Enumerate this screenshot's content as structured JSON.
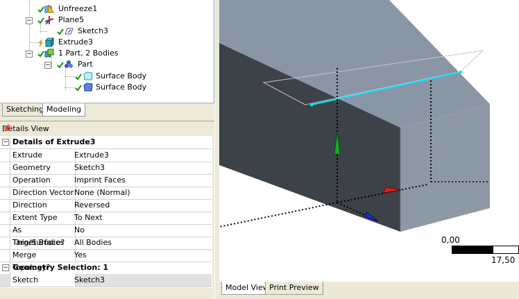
{
  "tree": {
    "items": [
      {
        "label": "Unfreeze1",
        "icon": "unfreeze-icon"
      },
      {
        "label": "Plane5",
        "icon": "plane-icon"
      },
      {
        "label": "Sketch3",
        "icon": "sketch-icon"
      },
      {
        "label": "Extrude3",
        "icon": "extrude-icon"
      },
      {
        "label": "1 Part, 2 Bodies",
        "icon": "part-bodies-icon"
      },
      {
        "label": "Part",
        "icon": "part-icon"
      },
      {
        "label": "Surface Body",
        "icon": "surface-body-icon"
      },
      {
        "label": "Surface Body",
        "icon": "surface-body-icon"
      }
    ]
  },
  "left_tabs": {
    "sketching": "Sketching",
    "modeling": "Modeling"
  },
  "details": {
    "title": "Details View",
    "group1": "Details of Extrude3",
    "rows": [
      {
        "label": "Extrude",
        "value": "Extrude3"
      },
      {
        "label": "Geometry",
        "value": "Sketch3"
      },
      {
        "label": "Operation",
        "value": "Imprint Faces"
      },
      {
        "label": "Direction Vector",
        "value": "None (Normal)"
      },
      {
        "label": "Direction",
        "value": "Reversed"
      },
      {
        "label": "Extent Type",
        "value": "To Next"
      },
      {
        "label": "As Thin/Surface?",
        "value": "No"
      },
      {
        "label": "Target Bodies",
        "value": "All Bodies"
      },
      {
        "label": "Merge Topology?",
        "value": "Yes"
      }
    ],
    "group2": "Geometry Selection: 1",
    "row_sel": {
      "label": "Sketch",
      "value": "Sketch3"
    }
  },
  "viewport": {
    "scale_start": "0,00",
    "scale_end": "17,50"
  },
  "view_tabs": {
    "model": "Model View",
    "print": "Print Preview"
  },
  "colors": {
    "body_top": "#8a96a6",
    "body_front": "#3c4248",
    "body_side": "#8e99a6",
    "sketch_line": "#00e5ff"
  }
}
